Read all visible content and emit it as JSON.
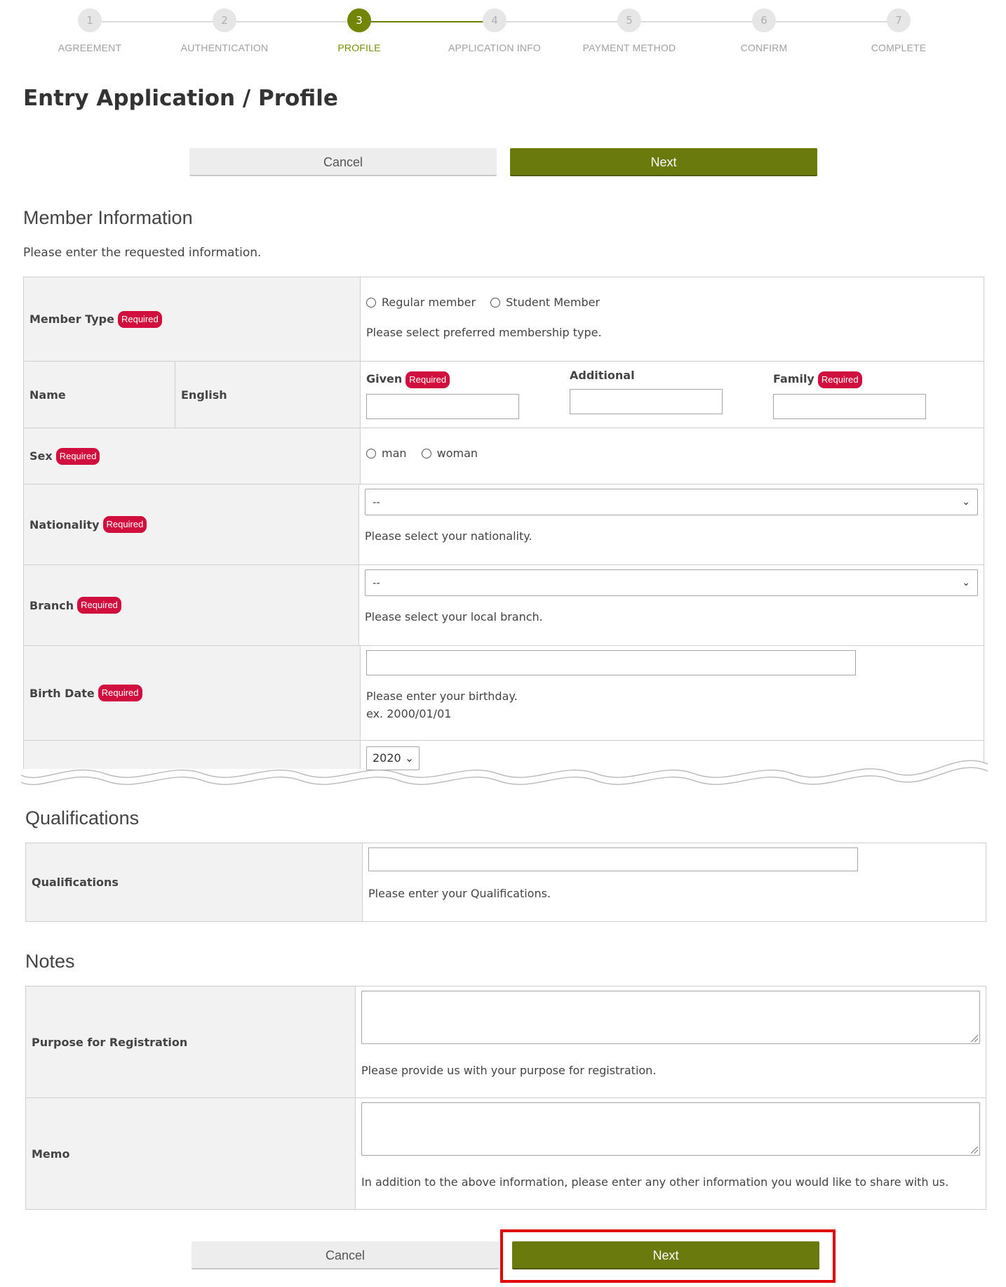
{
  "stepper": {
    "steps": [
      {
        "num": "1",
        "label": "AGREEMENT"
      },
      {
        "num": "2",
        "label": "AUTHENTICATION"
      },
      {
        "num": "3",
        "label": "PROFILE"
      },
      {
        "num": "4",
        "label": "APPLICATION INFO"
      },
      {
        "num": "5",
        "label": "PAYMENT METHOD"
      },
      {
        "num": "6",
        "label": "CONFIRM"
      },
      {
        "num": "7",
        "label": "COMPLETE"
      }
    ],
    "active_index": 2
  },
  "page_title": "Entry Application / Profile",
  "buttons": {
    "cancel": "Cancel",
    "next": "Next"
  },
  "member_info": {
    "title": "Member Information",
    "lead": "Please enter the requested information.",
    "required_badge": "Required",
    "member_type": {
      "label": "Member Type",
      "options": [
        "Regular member",
        "Student Member"
      ],
      "hint": "Please select preferred membership type."
    },
    "name": {
      "label": "Name",
      "sublabel": "English",
      "given": "Given",
      "additional": "Additional",
      "family": "Family"
    },
    "sex": {
      "label": "Sex",
      "options": [
        "man",
        "woman"
      ]
    },
    "nationality": {
      "label": "Nationality",
      "selected": "--",
      "hint": "Please select your nationality."
    },
    "branch": {
      "label": "Branch",
      "selected": "--",
      "hint": "Please select your local branch."
    },
    "birth_date": {
      "label": "Birth Date",
      "hint": "Please enter your birthday.",
      "example": "ex. 2000/01/01"
    },
    "year_select": "2020"
  },
  "qualifications": {
    "title": "Qualifications",
    "label": "Qualifications",
    "hint": "Please enter your Qualifications."
  },
  "notes": {
    "title": "Notes",
    "purpose": {
      "label": "Purpose for Registration",
      "hint": "Please provide us with your purpose for registration."
    },
    "memo": {
      "label": "Memo",
      "hint": "In addition to the above information, please enter any other information you would like to share with us."
    }
  },
  "colors": {
    "accent": "#6b7a0c",
    "required": "#d10f3f",
    "highlight": "#e00000"
  }
}
